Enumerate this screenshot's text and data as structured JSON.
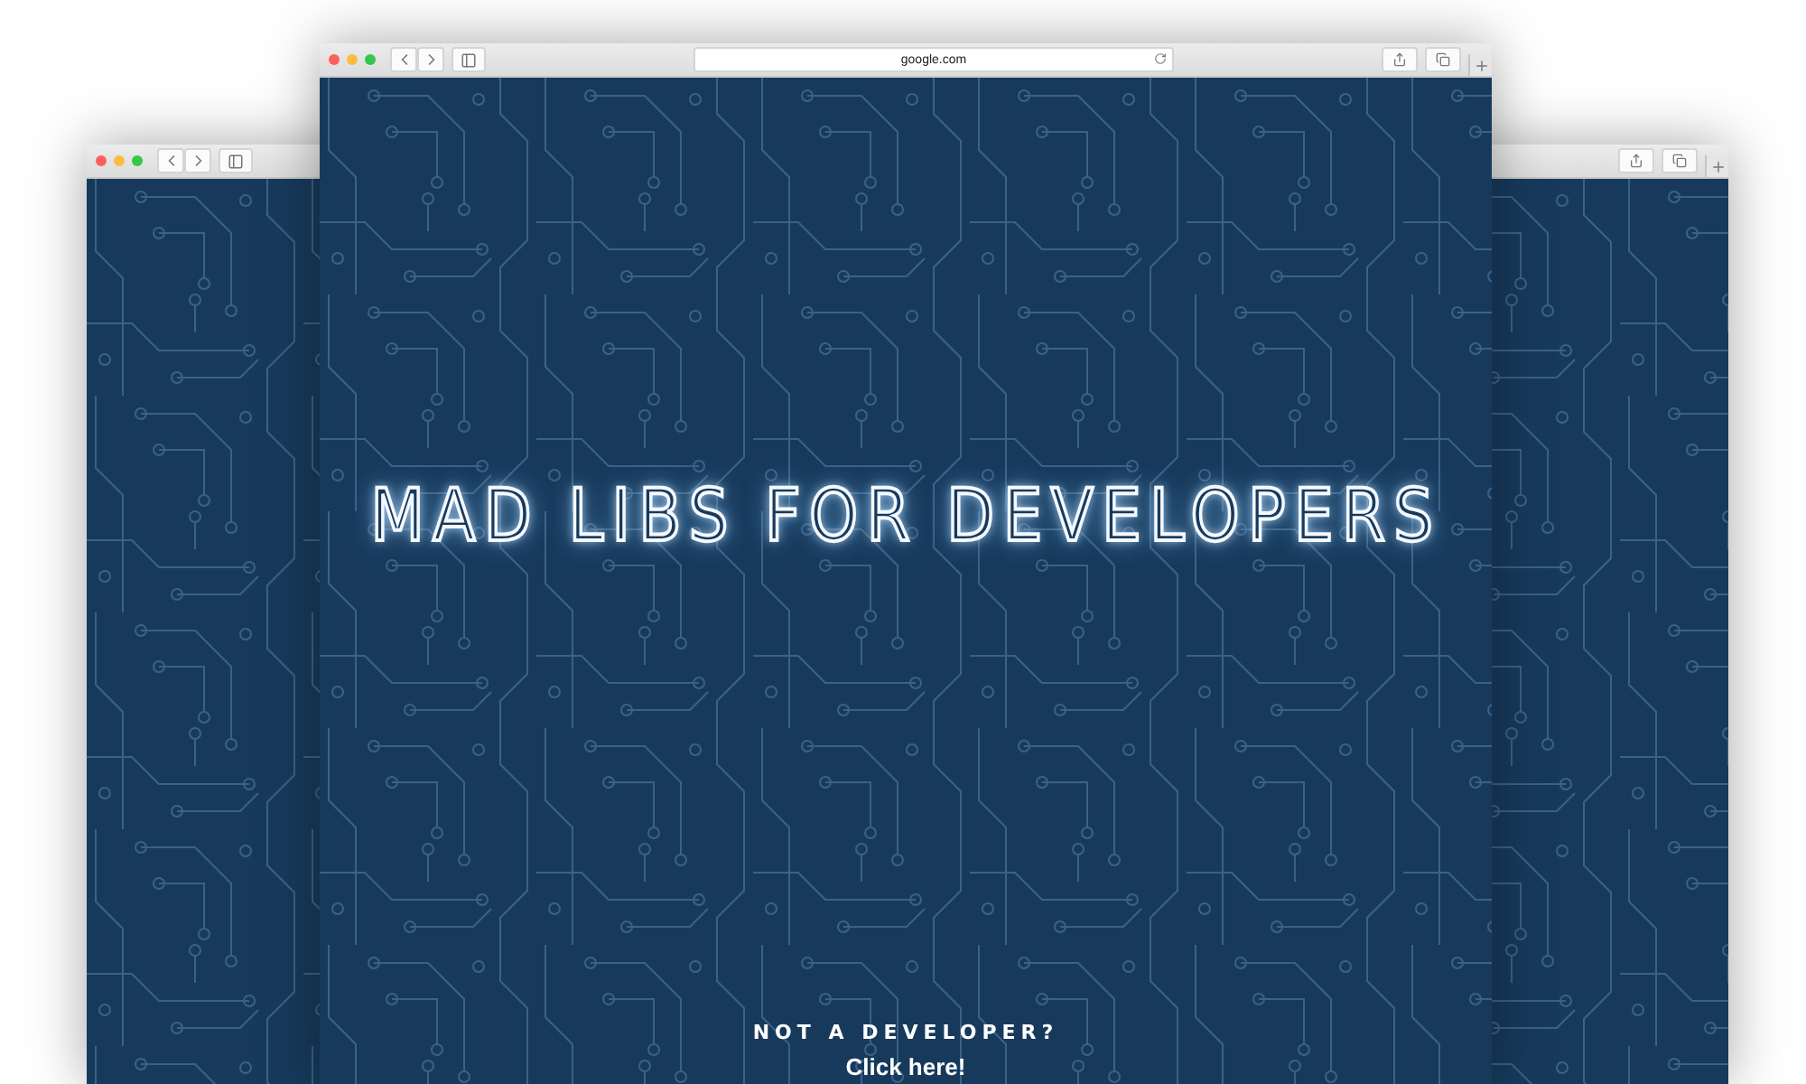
{
  "windows": [
    {
      "kind": "back-left"
    },
    {
      "kind": "back-right"
    },
    {
      "kind": "front",
      "url": "google.com",
      "title": "MAD LIBS FOR DEVELOPERS",
      "prompt": "NOT A DEVELOPER?",
      "link": "Click here!"
    }
  ]
}
